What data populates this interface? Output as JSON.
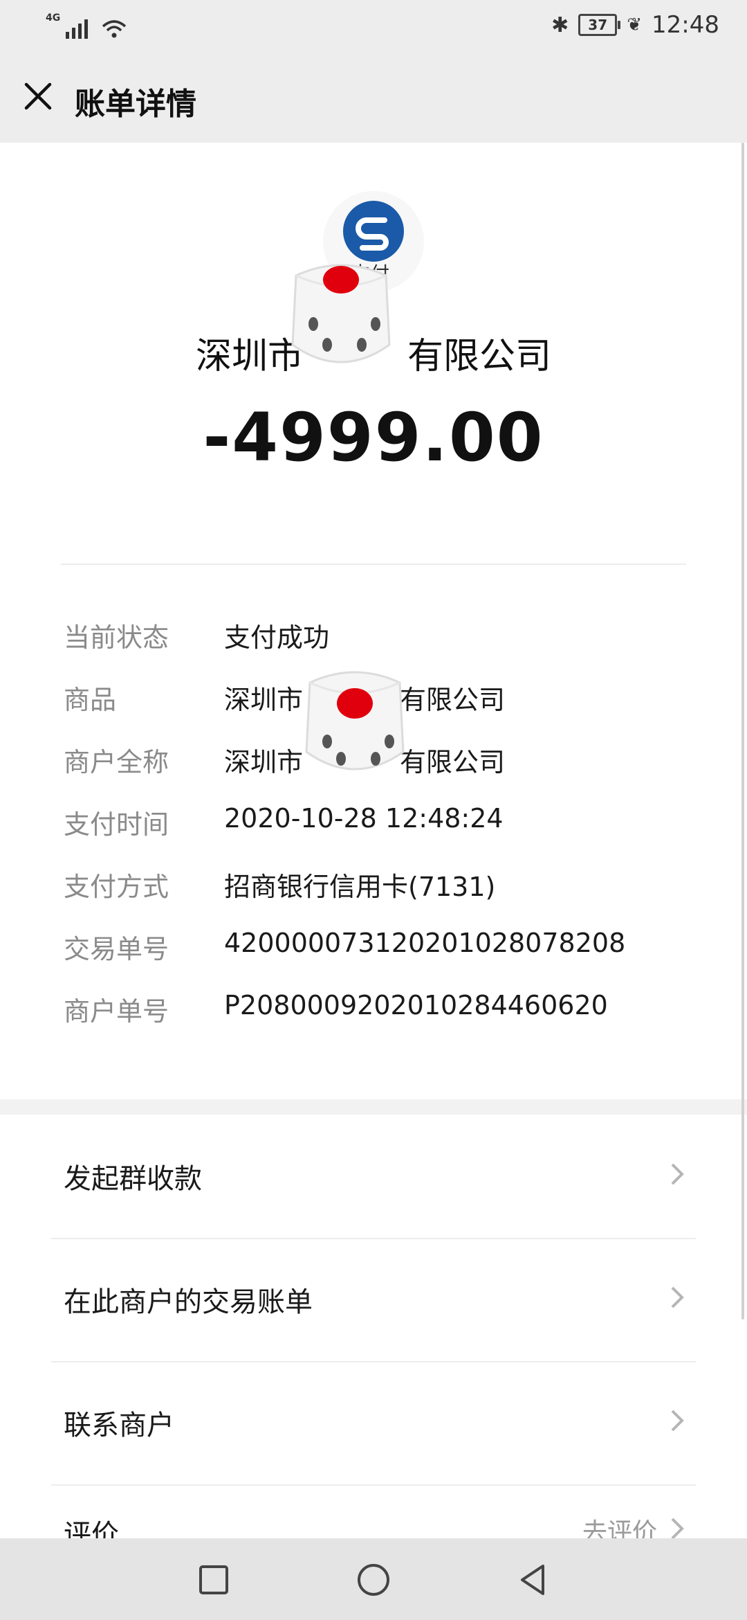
{
  "status_bar": {
    "network": "4G",
    "battery": "37",
    "time": "12:48"
  },
  "header": {
    "title": "账单详情",
    "close_icon": "close-icon"
  },
  "summary": {
    "logo_text": "支付",
    "merchant": "深圳市",
    "merchant_suffix": "有限公司",
    "amount": "-4999.00"
  },
  "details": [
    {
      "label": "当前状态",
      "value": "支付成功"
    },
    {
      "label": "商品",
      "value": "深圳市",
      "value_suffix": "有限公司"
    },
    {
      "label": "商户全称",
      "value": "深圳市",
      "value_suffix": "有限公司"
    },
    {
      "label": "支付时间",
      "value": "2020-10-28 12:48:24"
    },
    {
      "label": "支付方式",
      "value": "招商银行信用卡(7131)"
    },
    {
      "label": "交易单号",
      "value": "420000073120201028078208"
    },
    {
      "label": "商户单号",
      "value": "P2080009202010284460620"
    }
  ],
  "actions": [
    {
      "label": "发起群收款"
    },
    {
      "label": "在此商户的交易账单"
    },
    {
      "label": "联系商户"
    },
    {
      "label": "评价",
      "status": "去评价"
    }
  ],
  "colors": {
    "background": "#f2f2f2",
    "card": "#ffffff",
    "label_gray": "#8a8a8a",
    "logo_blue": "#1a5aa8",
    "dice_red": "#e0000d"
  }
}
